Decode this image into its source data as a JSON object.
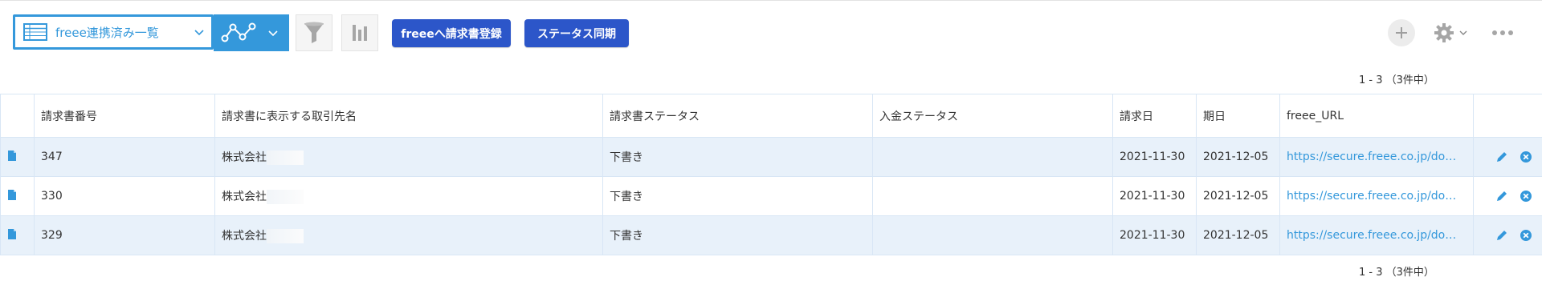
{
  "toolbar": {
    "view_selector_label": "freee連携済み一覧",
    "freee_register_button": "freeeへ請求書登録",
    "status_sync_button": "ステータス同期"
  },
  "pagination": {
    "top": "1 - 3 （3件中）",
    "bottom": "1 - 3 （3件中）"
  },
  "table": {
    "headers": [
      "請求書番号",
      "請求書に表示する取引先名",
      "請求書ステータス",
      "入金ステータス",
      "請求日",
      "期日",
      "freee_URL"
    ],
    "rows": [
      {
        "number": "347",
        "client": "株式会社",
        "invoice_status": "下書き",
        "payment_status": "",
        "invoice_date": "2021-11-30",
        "due_date": "2021-12-05",
        "freee_url": "https://secure.freee.co.jp/do…"
      },
      {
        "number": "330",
        "client": "株式会社",
        "invoice_status": "下書き",
        "payment_status": "",
        "invoice_date": "2021-11-30",
        "due_date": "2021-12-05",
        "freee_url": "https://secure.freee.co.jp/do…"
      },
      {
        "number": "329",
        "client": "株式会社",
        "invoice_status": "下書き",
        "payment_status": "",
        "invoice_date": "2021-11-30",
        "due_date": "2021-12-05",
        "freee_url": "https://secure.freee.co.jp/do…"
      }
    ]
  },
  "colors": {
    "accent": "#3498db",
    "action_button": "#2c56c9",
    "row_stripe": "#e8f1fa"
  },
  "icons": [
    "table-icon",
    "chevron-down-icon",
    "graph-icon",
    "filter-icon",
    "bar-chart-icon",
    "plus-icon",
    "gear-icon",
    "more-icon",
    "document-icon",
    "pencil-icon",
    "delete-icon"
  ]
}
